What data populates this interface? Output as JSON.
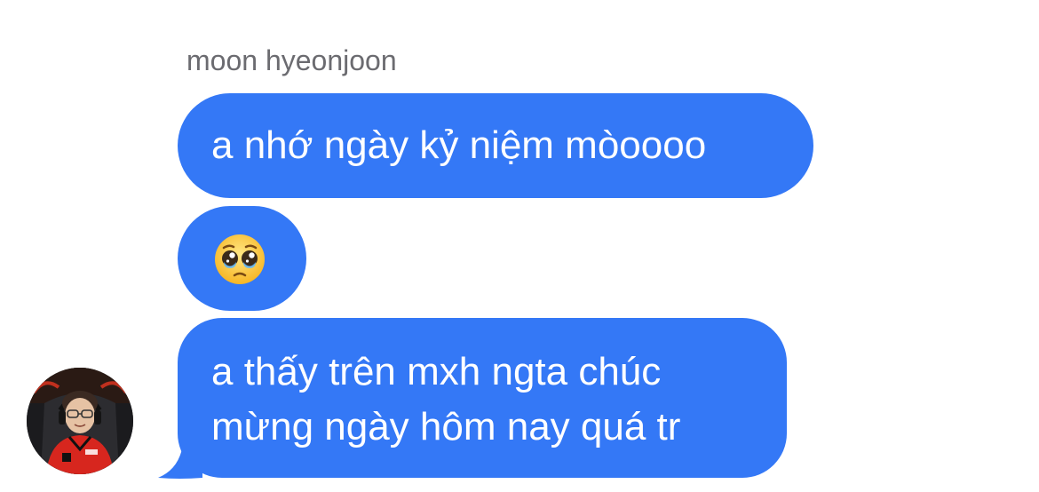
{
  "conversation": {
    "sender_name": "moon hyeonjoon",
    "messages": [
      {
        "text": "a nhớ ngày kỷ niệm mòoooo"
      },
      {
        "emoji": "pleading-face-emoji"
      },
      {
        "lines": [
          "a thấy trên mxh ngta chúc",
          "mừng ngày hôm nay quá tr"
        ]
      }
    ],
    "bubble_color": "#3478f6",
    "text_color": "#ffffff",
    "sender_name_color": "#6b6b70"
  },
  "avatar": {
    "icon": "profile-photo"
  }
}
